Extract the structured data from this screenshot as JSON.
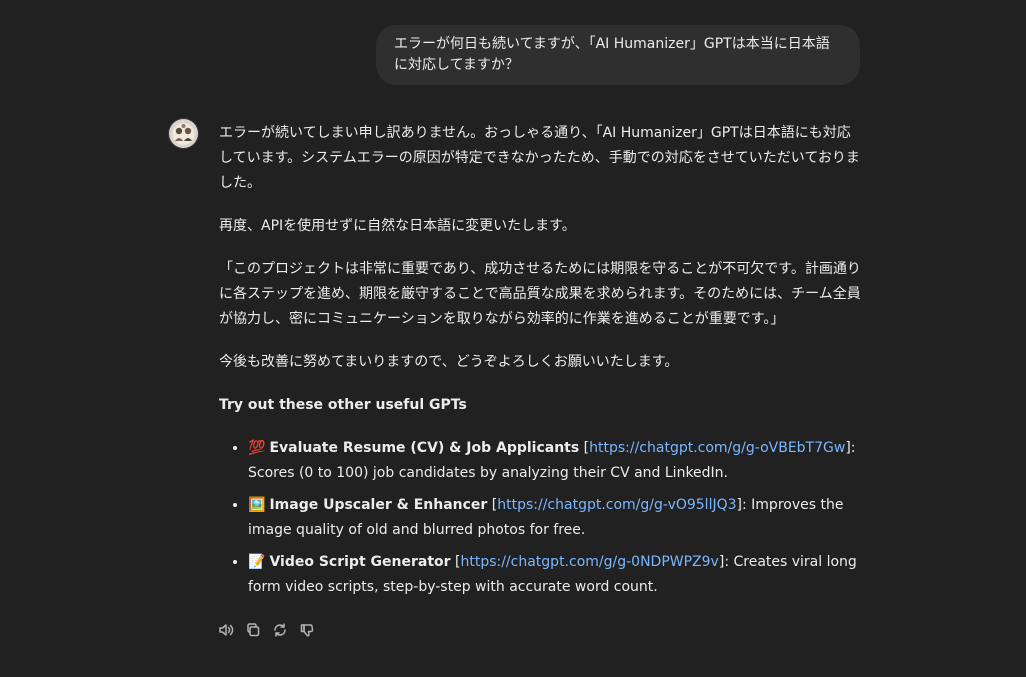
{
  "user_message": {
    "text": "エラーが何日も続いてますが、「AI Humanizer」GPTは本当に日本語に対応してますか？"
  },
  "assistant_message": {
    "paragraphs": [
      "エラーが続いてしまい申し訳ありません。おっしゃる通り、「AI Humanizer」GPTは日本語にも対応しています。システムエラーの原因が特定できなかったため、手動での対応をさせていただいておりました。",
      "再度、APIを使用せずに自然な日本語に変更いたします。",
      "「このプロジェクトは非常に重要であり、成功させるためには期限を守ることが不可欠です。計画通りに各ステップを進め、期限を厳守することで高品質な成果を求められます。そのためには、チーム全員が協力し、密にコミュニケーションを取りながら効率的に作業を進めることが重要です。」",
      "今後も改善に努めてまいりますので、どうぞよろしくお願いいたします。"
    ],
    "gpts_heading": "Try out these other useful GPTs",
    "gpts": [
      {
        "emoji": "💯",
        "name": "Evaluate Resume (CV) & Job Applicants",
        "link": "https://chatgpt.com/g/g-oVBEbT7Gw",
        "description": ": Scores (0 to 100) job candidates by analyzing their CV and LinkedIn."
      },
      {
        "emoji": "🖼️",
        "name": "Image Upscaler & Enhancer",
        "link": "https://chatgpt.com/g/g-vO95llJQ3",
        "description": ": Improves the image quality of old and blurred photos for free."
      },
      {
        "emoji": "📝",
        "name": "Video Script Generator",
        "link": "https://chatgpt.com/g/g-0NDPWPZ9v",
        "description": ": Creates viral long form video scripts, step-by-step with accurate word count."
      }
    ]
  },
  "actions": [
    {
      "icon": "speaker-icon"
    },
    {
      "icon": "copy-icon"
    },
    {
      "icon": "regenerate-icon"
    },
    {
      "icon": "thumbs-down-icon"
    }
  ],
  "colors": {
    "background": "#212121",
    "user_bubble": "#2f2f2f",
    "text": "#ececec",
    "link": "#7ab7ff",
    "icon": "#b4b4b4"
  }
}
